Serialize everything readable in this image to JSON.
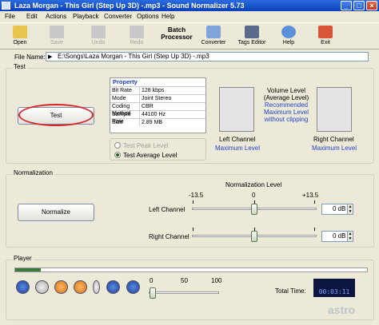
{
  "window": {
    "title": "Laza Morgan - This Girl (Step Up 3D) -.mp3 - Sound Normalizer 5.73"
  },
  "menu": [
    "File",
    "Edit",
    "Actions",
    "Playback",
    "Converter",
    "Options",
    "Help"
  ],
  "toolbar": {
    "open": "Open",
    "save": "Save",
    "undo": "Undo",
    "redo": "Redo",
    "batch_line1": "Batch",
    "batch_line2": "Processor",
    "converter": "Converter",
    "tags_editor": "Tags Editor",
    "help": "Help",
    "exit": "Exit"
  },
  "file": {
    "label": "File Name:",
    "path": "E:\\Songs\\Laza Morgan - This Girl (Step Up 3D) -.mp3"
  },
  "test_group": {
    "label": "Test",
    "button": "Test",
    "property_header": "Property",
    "properties": [
      {
        "key": "Bit Rate",
        "value": "128 kbps"
      },
      {
        "key": "Mode",
        "value": "Joint Stereo"
      },
      {
        "key": "Coding Method",
        "value": "CBR"
      },
      {
        "key": "Sample Rate",
        "value": "44100 Hz"
      },
      {
        "key": "Size",
        "value": "2.89 MB"
      }
    ],
    "radio_peak": "Test Peak Level",
    "radio_average": "Test Average Level",
    "left_channel": "Left Channel",
    "right_channel": "Right Channel",
    "max_left": "Maximum Level",
    "max_right": "Maximum Level",
    "volume_line1": "Volume Level",
    "volume_line2": "(Average Level)",
    "rec_line1": "Recommended",
    "rec_line2": "Maximum Level",
    "rec_line3": "without clipping"
  },
  "normalization": {
    "label": "Normalization",
    "button": "Normalize",
    "level_title": "Normalization Level",
    "min": "-13.5",
    "mid": "0",
    "max": "+13.5",
    "left_label": "Left Channel",
    "right_label": "Right Channel",
    "left_db": "0 dB",
    "right_db": "0 dB"
  },
  "player": {
    "label": "Player",
    "vol_0": "0",
    "vol_50": "50",
    "vol_100": "100",
    "total_label": "Total Time:",
    "total_time": "00:03:11"
  },
  "watermark": "astro"
}
